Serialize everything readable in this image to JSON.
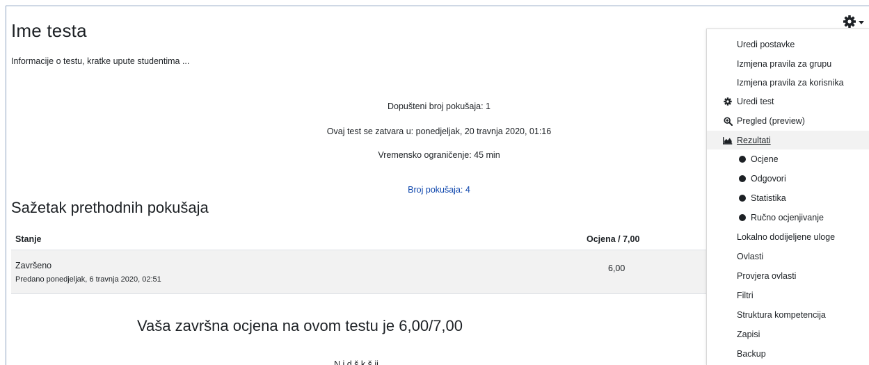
{
  "page": {
    "title": "Ime testa",
    "intro": "Informacije o testu, kratke upute studentima ..."
  },
  "quiz_info": {
    "attempts_allowed": "Dopušteni broj pokušaja: 1",
    "closes": "Ovaj test se zatvara u: ponedjeljak, 20 travnja 2020, 01:16",
    "time_limit": "Vremensko ograničenje: 45 min",
    "attempts_link": "Broj pokušaja: 4"
  },
  "summary": {
    "title": "Sažetak prethodnih pokušaja",
    "columns": {
      "state": "Stanje",
      "grade": "Ocjena / 7,00"
    },
    "rows": [
      {
        "state": "Završeno",
        "submitted": "Predano ponedjeljak, 6 travnja 2020, 02:51",
        "grade": "6,00"
      }
    ]
  },
  "final_grade": "Vaša završna ocjena na ovom testu je 6,00/7,00",
  "cutoff_text": "N   i   d   š   k       š   ij",
  "settings_menu": {
    "trigger_icon": "gear-icon",
    "items": [
      {
        "label": "Uredi postavke",
        "kind": "plain"
      },
      {
        "label": "Izmjena pravila za grupu",
        "kind": "plain"
      },
      {
        "label": "Izmjena pravila za korisnika",
        "kind": "plain"
      },
      {
        "label": "Uredi test",
        "kind": "icon",
        "icon": "gear-icon"
      },
      {
        "label": "Pregled (preview)",
        "kind": "icon",
        "icon": "zoom-icon"
      },
      {
        "label": "Rezultati",
        "kind": "icon",
        "icon": "area-chart-icon",
        "active": true
      },
      {
        "label": "Ocjene",
        "kind": "sub"
      },
      {
        "label": "Odgovori",
        "kind": "sub"
      },
      {
        "label": "Statistika",
        "kind": "sub"
      },
      {
        "label": "Ručno ocjenjivanje",
        "kind": "sub"
      },
      {
        "label": "Lokalno dodijeljene uloge",
        "kind": "plain"
      },
      {
        "label": "Ovlasti",
        "kind": "plain"
      },
      {
        "label": "Provjera ovlasti",
        "kind": "plain"
      },
      {
        "label": "Filtri",
        "kind": "plain"
      },
      {
        "label": "Struktura kompetencija",
        "kind": "plain"
      },
      {
        "label": "Zapisi",
        "kind": "plain"
      },
      {
        "label": "Backup",
        "kind": "plain"
      }
    ]
  },
  "colors": {
    "link": "#0f47ad",
    "text": "#1d2125",
    "row_bg": "#f2f2f2"
  }
}
